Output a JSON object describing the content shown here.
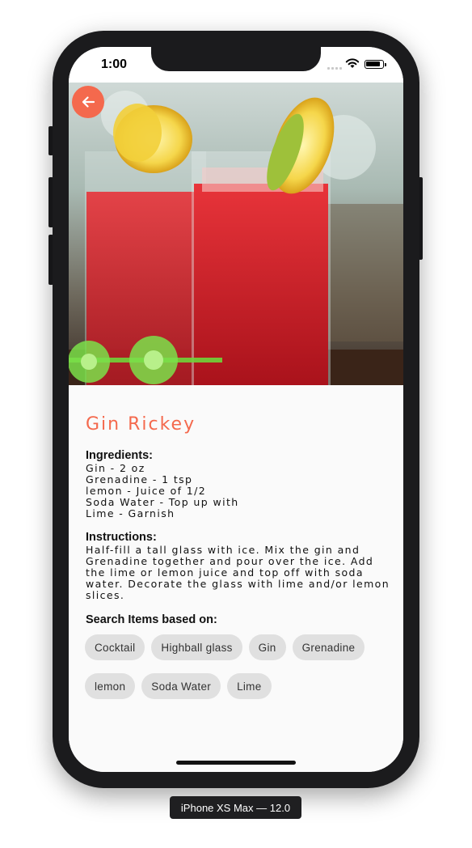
{
  "status_bar": {
    "time": "1:00"
  },
  "drink": {
    "name": "Gin Rickey",
    "ingredients_heading": "Ingredients:",
    "ingredients": [
      "Gin - 2 oz",
      "Grenadine - 1 tsp",
      "lemon - Juice of 1/2",
      "Soda Water - Top up with",
      "Lime - Garnish"
    ],
    "instructions_heading": "Instructions:",
    "instructions": "Half-fill a tall glass with ice. Mix the gin and Grenadine together and pour over the ice. Add the lime or lemon juice and top off with soda water. Decorate the glass with lime and/or lemon slices.",
    "search_heading": "Search Items based on:",
    "search_tags_row1": [
      "Cocktail",
      "Highball glass",
      "Gin",
      "Grenadine"
    ],
    "search_tags_row2": [
      "lemon",
      "Soda Water",
      "Lime"
    ]
  },
  "back_button_icon": "arrow-left-icon",
  "device_label": "iPhone XS Max — 12.0",
  "colors": {
    "accent": "#f4694d",
    "chip_bg": "#e0e0e0",
    "background": "#fafafa"
  }
}
